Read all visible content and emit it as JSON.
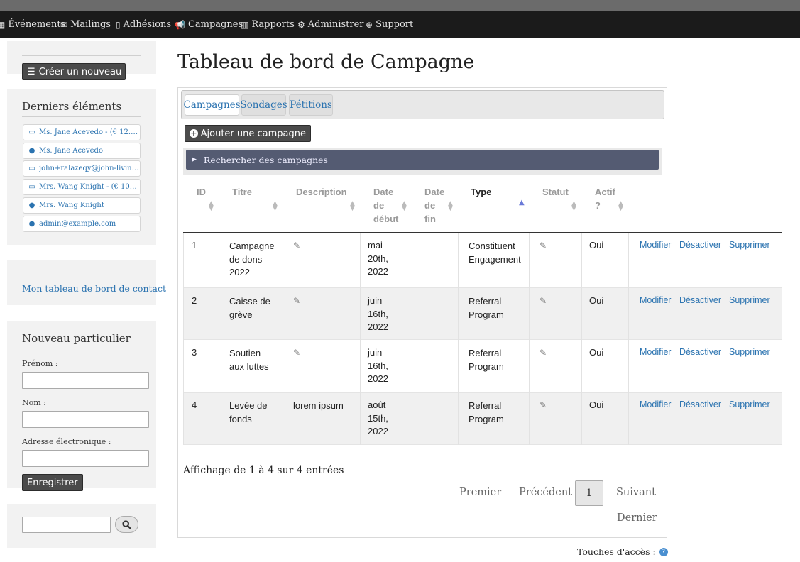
{
  "menu": {
    "items": [
      {
        "label": "Événements",
        "icon": "calendar-icon"
      },
      {
        "label": "Mailings",
        "icon": "envelope-icon"
      },
      {
        "label": "Adhésions",
        "icon": "id-card-icon"
      },
      {
        "label": "Campagnes",
        "icon": "bullhorn-icon"
      },
      {
        "label": "Rapports",
        "icon": "bar-chart-icon"
      },
      {
        "label": "Administrer",
        "icon": "cogs-icon"
      },
      {
        "label": "Support",
        "icon": "life-ring-icon"
      }
    ]
  },
  "sidebar": {
    "create_button": "Créer un nouveau",
    "recent_title": "Derniers éléments",
    "recent_items": [
      {
        "label": "Ms. Jane Acevedo - (€ 12.00 …",
        "icon": "credit-card-icon"
      },
      {
        "label": "Ms. Jane Acevedo",
        "icon": "user-icon"
      },
      {
        "label": "john+ralazeqy@john-livingst…",
        "icon": "credit-card-icon"
      },
      {
        "label": "Mrs. Wang Knight - (€ 100.0…",
        "icon": "credit-card-icon"
      },
      {
        "label": "Mrs. Wang Knight",
        "icon": "user-icon"
      },
      {
        "label": "admin@example.com",
        "icon": "user-icon"
      }
    ],
    "dashboard_link": "Mon tableau de bord de contact",
    "new_individual": {
      "title": "Nouveau particulier",
      "first_name_label": "Prénom :",
      "last_name_label": "Nom :",
      "email_label": "Adresse électronique :",
      "save_button": "Enregistrer"
    }
  },
  "main": {
    "title": "Tableau de bord de Campagne",
    "tabs": [
      {
        "label": "Campagnes",
        "active": true
      },
      {
        "label": "Sondages",
        "active": false
      },
      {
        "label": "Pétitions",
        "active": false
      }
    ],
    "add_button": "Ajouter une campagne",
    "search_accordion": "Rechercher des campagnes",
    "table": {
      "headers": {
        "id": "ID",
        "title": "Titre",
        "description": "Description",
        "start_date": [
          "Date",
          "de",
          "début"
        ],
        "end_date": [
          "Date",
          "de",
          "fin"
        ],
        "type": "Type",
        "status": "Statut",
        "active": [
          "Actif",
          "?"
        ]
      },
      "rows": [
        {
          "id": "1",
          "title": [
            "Campagne",
            "de dons",
            "2022"
          ],
          "description": "",
          "start": [
            "mai",
            "20th,",
            "2022"
          ],
          "end": "",
          "type": [
            "Constituent",
            "Engagement"
          ],
          "active": "Oui",
          "actions": [
            "Modifier",
            "Désactiver",
            "Supprimer"
          ]
        },
        {
          "id": "2",
          "title": [
            "Caisse de",
            "grève"
          ],
          "description": "",
          "start": [
            "juin",
            "16th,",
            "2022"
          ],
          "end": "",
          "type": [
            "Referral",
            "Program"
          ],
          "active": "Oui",
          "actions": [
            "Modifier",
            "Désactiver",
            "Supprimer"
          ]
        },
        {
          "id": "3",
          "title": [
            "Soutien",
            "aux luttes"
          ],
          "description": "",
          "start": [
            "juin",
            "16th,",
            "2022"
          ],
          "end": "",
          "type": [
            "Referral",
            "Program"
          ],
          "active": "Oui",
          "actions": [
            "Modifier",
            "Désactiver",
            "Supprimer"
          ]
        },
        {
          "id": "4",
          "title": [
            "Levée de",
            "fonds"
          ],
          "description": "lorem ipsum",
          "start": [
            "août",
            "15th,",
            "2022"
          ],
          "end": "",
          "type": [
            "Referral",
            "Program"
          ],
          "active": "Oui",
          "actions": [
            "Modifier",
            "Désactiver",
            "Supprimer"
          ]
        }
      ]
    },
    "info": "Affichage de 1 à 4 sur 4 entrées",
    "pagination": {
      "first": "Premier",
      "previous": "Précédent",
      "current": "1",
      "next": "Suivant",
      "last": "Dernier"
    },
    "access_keys": "Touches d'accès :",
    "help_icon": "question-icon"
  }
}
